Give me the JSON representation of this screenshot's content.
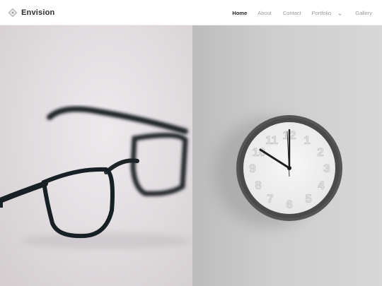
{
  "brand": {
    "name": "Envision",
    "logo_icon": "diamond-logo-icon"
  },
  "nav": {
    "items": [
      {
        "label": "Home",
        "active": true
      },
      {
        "label": "About",
        "active": false
      },
      {
        "label": "Contact",
        "active": false
      },
      {
        "label": "Portfolio",
        "active": false,
        "has_dropdown": true
      },
      {
        "label": "Gallery",
        "active": false
      }
    ]
  },
  "images": {
    "left": "eyeglasses-photo",
    "right": "wall-clock-photo"
  },
  "colors": {
    "header_bg": "#ffffff",
    "active_nav": "#222222",
    "inactive_nav": "#9a9a9a",
    "brand_text": "#2c2c2c"
  }
}
